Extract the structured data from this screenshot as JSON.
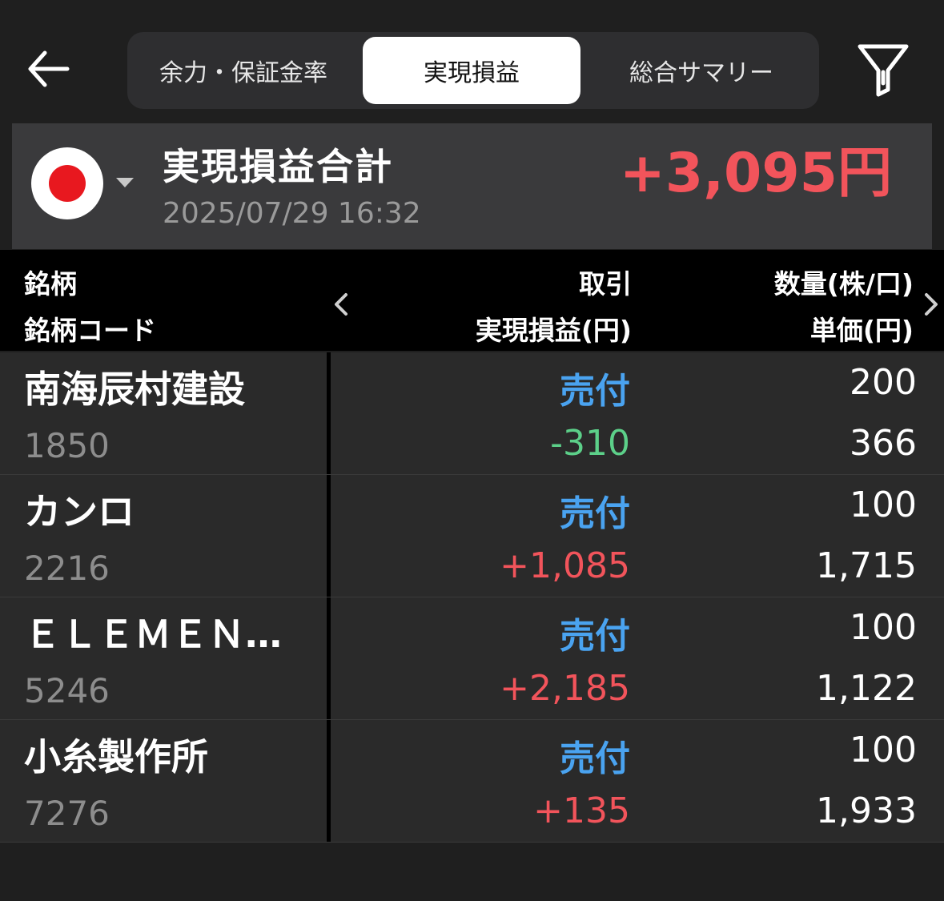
{
  "tabs": {
    "t1": "余力・保証金率",
    "t2": "実現損益",
    "t3": "総合サマリー"
  },
  "summary": {
    "title": "実現損益合計",
    "datetime": "2025/07/29 16:32",
    "total": "+3,095円"
  },
  "header": {
    "col1_top": "銘柄",
    "col1_bottom": "銘柄コード",
    "col2_top": "取引",
    "col2_bottom": "実現損益(円)",
    "col3_top": "数量(株/口)",
    "col3_bottom": "単価(円)"
  },
  "colors": {
    "profit": "#f2545b",
    "loss": "#5cd089",
    "side": "#4aa3f0"
  },
  "rows": [
    {
      "name": "南海辰村建設",
      "code": "1850",
      "side": "売付",
      "pl": "-310",
      "qty": "200",
      "price": "366"
    },
    {
      "name": "カンロ",
      "code": "2216",
      "side": "売付",
      "pl": "+1,085",
      "qty": "100",
      "price": "1,715"
    },
    {
      "name": "ＥＬＥＭＥＮ…",
      "code": "5246",
      "side": "売付",
      "pl": "+2,185",
      "qty": "100",
      "price": "1,122"
    },
    {
      "name": "小糸製作所",
      "code": "7276",
      "side": "売付",
      "pl": "+135",
      "qty": "100",
      "price": "1,933"
    }
  ]
}
